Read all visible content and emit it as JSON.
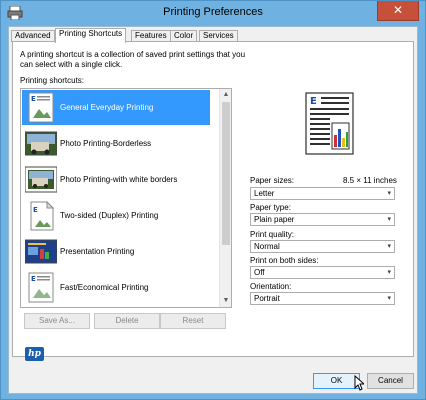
{
  "window": {
    "title": "Printing Preferences",
    "close_glyph": "✕"
  },
  "tabs": [
    {
      "label": "Advanced"
    },
    {
      "label": "Printing Shortcuts"
    },
    {
      "label": "Features"
    },
    {
      "label": "Color"
    },
    {
      "label": "Services"
    }
  ],
  "panel": {
    "description": "A printing shortcut is a collection of saved print settings that you can select with a single click.",
    "shortcuts_label": "Printing shortcuts:",
    "shortcuts": [
      {
        "label": "General Everyday Printing",
        "selected": true
      },
      {
        "label": "Photo Printing-Borderless",
        "selected": false
      },
      {
        "label": "Photo Printing-with white borders",
        "selected": false
      },
      {
        "label": "Two-sided (Duplex) Printing",
        "selected": false
      },
      {
        "label": "Presentation Printing",
        "selected": false
      },
      {
        "label": "Fast/Economical Printing",
        "selected": false
      }
    ],
    "buttons": {
      "save_as": "Save As...",
      "delete": "Delete",
      "reset": "Reset"
    }
  },
  "settings": {
    "paper_sizes_label": "Paper sizes:",
    "paper_sizes_value": "8.5 × 11 inches",
    "paper_size_select": "Letter",
    "paper_type_label": "Paper type:",
    "paper_type_select": "Plain paper",
    "print_quality_label": "Print quality:",
    "print_quality_select": "Normal",
    "print_both_sides_label": "Print on both sides:",
    "print_both_sides_select": "Off",
    "orientation_label": "Orientation:",
    "orientation_select": "Portrait"
  },
  "footer": {
    "ok": "OK",
    "cancel": "Cancel",
    "logo_text": "hp"
  },
  "icons": {
    "chevron": "▾",
    "scroll_up": "▲",
    "scroll_down": "▼"
  },
  "colors": {
    "accent_selected": "#3399ff",
    "titlebar": "#6fb1e0",
    "close_button": "#c7503a"
  }
}
